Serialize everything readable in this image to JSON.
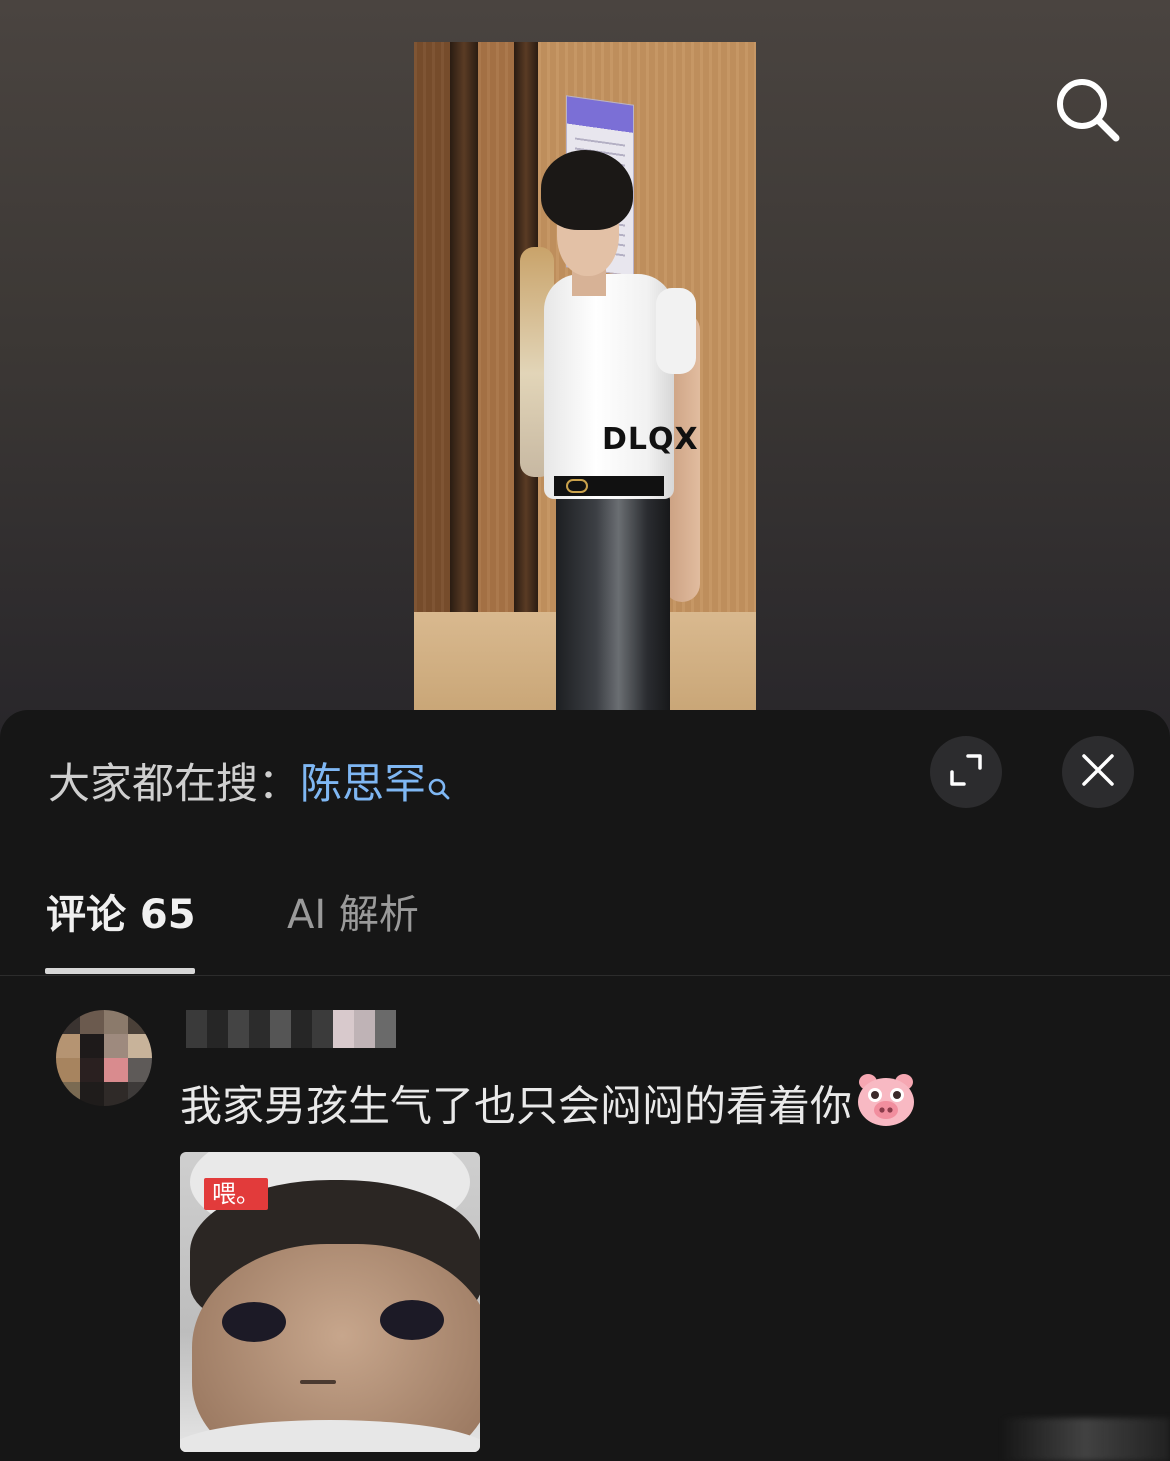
{
  "video": {
    "watermark": "DLQX",
    "search_icon": "search-icon"
  },
  "sheet": {
    "trending_label": "大家都在搜：",
    "trending_term": "陈思罕",
    "trending_icon": "search-icon",
    "expand_icon": "expand-icon",
    "close_icon": "close-icon",
    "tabs": [
      {
        "label": "评论 65",
        "active": true
      },
      {
        "label": "AI 解析",
        "active": false
      }
    ]
  },
  "comment": {
    "text": "我家男孩生气了也只会闷闷的看着你",
    "emoji": "pig-face-emoji",
    "sticker_tag": "喂。"
  },
  "colors": {
    "background": "#161616",
    "trending_term": "#7fb7f3",
    "tag_red": "#e23b3b"
  }
}
